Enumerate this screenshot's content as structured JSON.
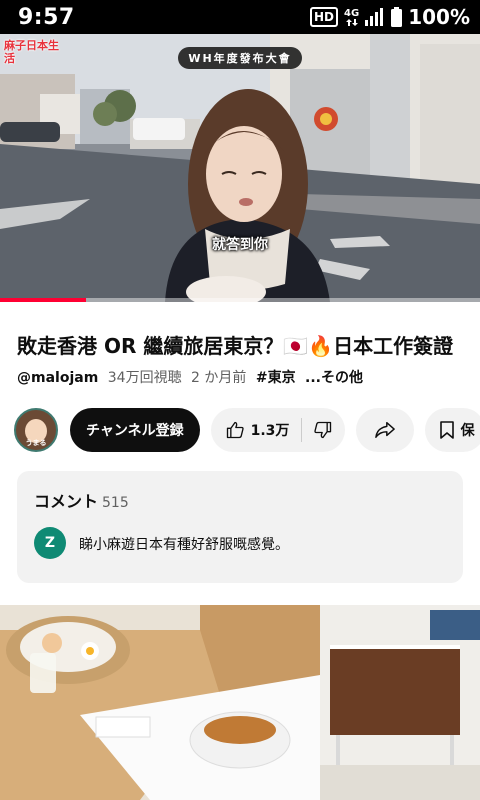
{
  "status_bar": {
    "time": "9:57",
    "hd_label": "HD",
    "network_label": "4G",
    "battery_percent": "100%"
  },
  "video": {
    "channel_logo_text": "麻子日本生活",
    "banner_text": "WH年度發布大會",
    "subtitle_text": "就答到你",
    "progress_fraction": 0.18
  },
  "info": {
    "title": "敗走香港 OR 繼續旅居東京？🇯🇵🔥日本工作簽證",
    "handle": "@malojam",
    "views": "34万回視聴",
    "age": "2 か月前",
    "tag": "#東京",
    "more": "...その他"
  },
  "actions": {
    "avatar_label": "うまる",
    "subscribe_label": "チャンネル登録",
    "like_count": "1.3万",
    "save_label": "保"
  },
  "comments": {
    "heading": "コメント",
    "count": "515",
    "first_author_initial": "Z",
    "first_comment": "睇小麻遊日本有種好舒服嘅感覺。"
  },
  "colors": {
    "progress": "#ff0033",
    "subscribe_bg": "#0f0f0f",
    "chip_bg": "#f2f2f2",
    "comment_avatar": "#0f8a74"
  }
}
